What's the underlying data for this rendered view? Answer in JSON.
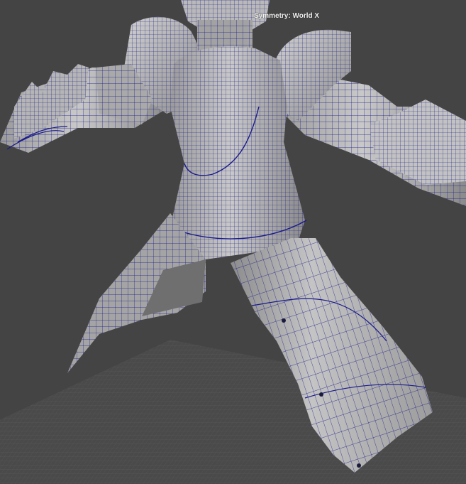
{
  "viewport": {
    "hud": {
      "symmetry_text": "Symmetry: World X"
    }
  },
  "colors": {
    "background": "#444444",
    "grid_floor": "#4c4c4c",
    "grid_line": "#5a5a5a",
    "mesh_fill_light": "#bdbdbd",
    "mesh_fill_mid": "#a6a6a6",
    "mesh_fill_dark": "#6e6e6e",
    "wireframe": "#1a1a8c",
    "hud_text": "#f2f2f2"
  }
}
